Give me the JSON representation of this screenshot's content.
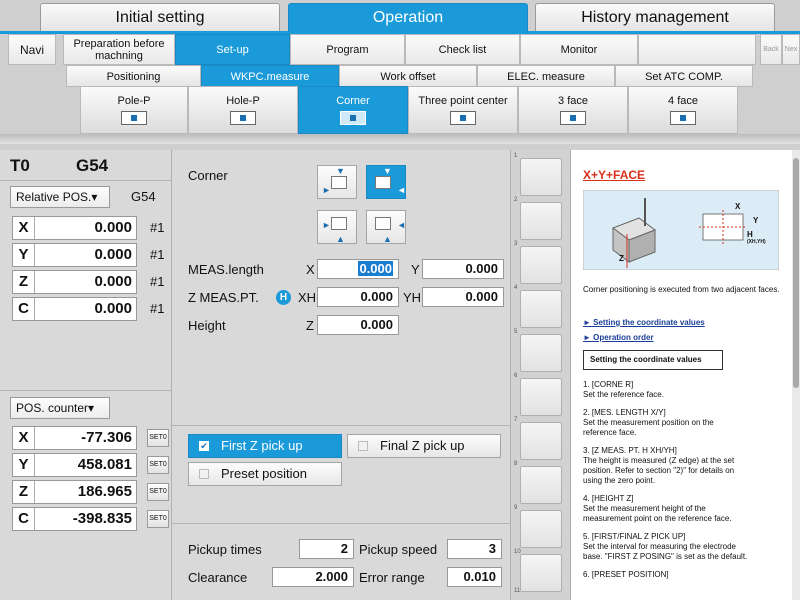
{
  "top_tabs": [
    "Initial setting",
    "Operation",
    "History management"
  ],
  "row2": {
    "navi": "Navi",
    "tabs": [
      "Preparation before machning",
      "Set-up",
      "Program",
      "Check list",
      "Monitor"
    ],
    "back": "Back",
    "next": "Nex"
  },
  "row3": [
    "Positioning",
    "WKPC.measure",
    "Work offset",
    "ELEC. measure",
    "Set ATC COMP."
  ],
  "row4": [
    "Pole-P",
    "Hole-P",
    "Corner",
    "Three point center",
    "3 face",
    "4 face"
  ],
  "left": {
    "tool": "T0",
    "coord": "G54",
    "rel_pos_btn": "Relative POS.▾",
    "rel_coord": "G54",
    "rel_axes": [
      {
        "axis": "X",
        "value": "0.000",
        "tag": "#1"
      },
      {
        "axis": "Y",
        "value": "0.000",
        "tag": "#1"
      },
      {
        "axis": "Z",
        "value": "0.000",
        "tag": "#1"
      },
      {
        "axis": "C",
        "value": "0.000",
        "tag": "#1"
      }
    ],
    "pos_counter_btn": "POS. counter▾",
    "counter_axes": [
      {
        "axis": "X",
        "value": "-77.306",
        "set": "SET0"
      },
      {
        "axis": "Y",
        "value": "458.081",
        "set": "SET0"
      },
      {
        "axis": "Z",
        "value": "186.965",
        "set": "SET0"
      },
      {
        "axis": "C",
        "value": "-398.835",
        "set": "SET0"
      }
    ]
  },
  "center": {
    "corner_label": "Corner",
    "meas_length_label": "MEAS.length",
    "x_label": "X",
    "x_value": "0.000",
    "y_label": "Y",
    "y_value": "0.000",
    "zmeas_label": "Z MEAS.PT.",
    "h_badge": "H",
    "xh_label": "XH",
    "xh_value": "0.000",
    "yh_label": "YH",
    "yh_value": "0.000",
    "height_label": "Height",
    "z_label": "Z",
    "z_value": "0.000",
    "first_z": "First Z pick up",
    "first_z_check": "✔",
    "final_z": "Final Z pick up",
    "preset": "Preset position",
    "pickup_times_label": "Pickup times",
    "pickup_times": "2",
    "pickup_speed_label": "Pickup speed",
    "pickup_speed": "3",
    "clearance_label": "Clearance",
    "clearance": "2.000",
    "error_range_label": "Error range",
    "error_range": "0.010"
  },
  "strip_numbers": [
    "1",
    "2",
    "3",
    "4",
    "5",
    "6",
    "7",
    "8",
    "9",
    "10",
    "11",
    "12"
  ],
  "help": {
    "title": "X+Y+FACE",
    "diagram_x": "X",
    "diagram_y": "Y",
    "diagram_h": "H",
    "diagram_hsub": "(XH,YH)",
    "diagram_z": "Z",
    "intro": "Corner positioning is executed from two adjacent faces.",
    "link1": "► Setting the coordinate values",
    "link2": "► Operation order",
    "section": "Setting the coordinate values",
    "items": [
      "1.  [CORNE R]",
      "     Set the reference face.",
      "2.  [MES. LENGTH X/Y]",
      "     Set the measurement position on the",
      "     reference face.",
      "3.  [Z MEAS. PT. H XH/YH]",
      "     The height is measured (Z edge) at the set",
      "     position. Refer to section \"2)\" for details on",
      "     using the zero point.",
      "4.  [HEIGHT Z]",
      "     Set the measurement height of the",
      "     measurement point on the reference face.",
      "5.  [FIRST/FINAL Z PICK UP]",
      "     Set the interval for measuring the electrode",
      "     base. \"FIRST Z POSING\" is set as the default.",
      "6.  [PRESET POSITION]"
    ]
  }
}
